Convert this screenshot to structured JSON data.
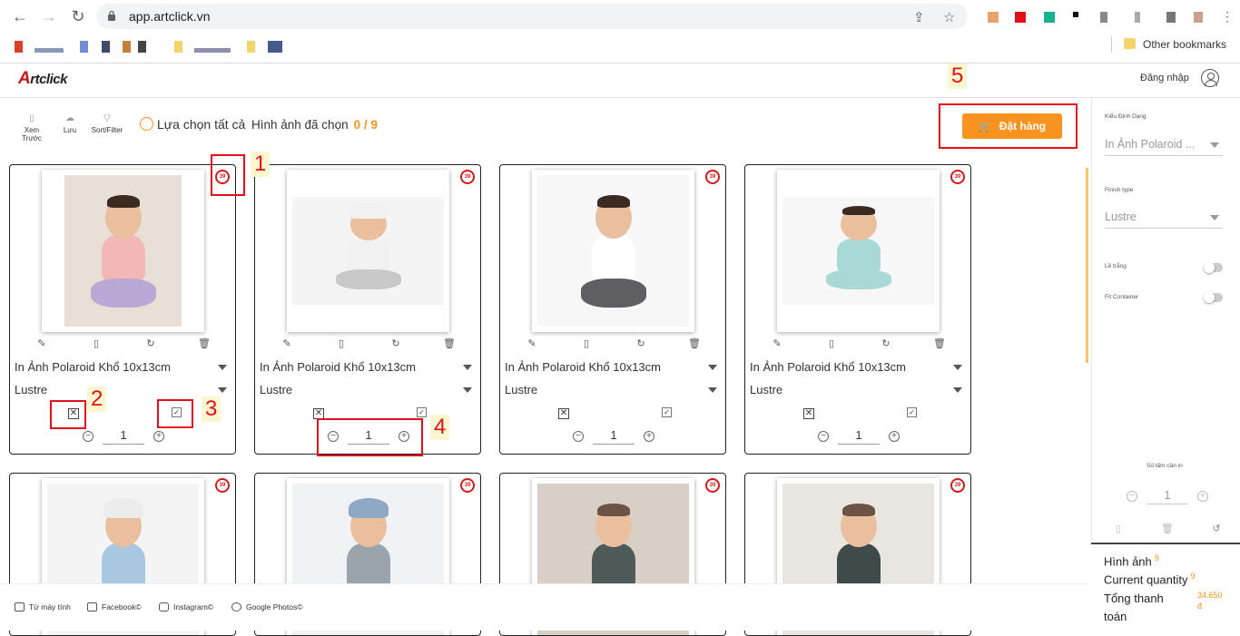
{
  "browser": {
    "url": "app.artclick.vn",
    "other_bookmarks": "Other bookmarks"
  },
  "app": {
    "logo": "rtclick",
    "logo_a": "A",
    "login": "Đăng nhập"
  },
  "toolbar": {
    "preview": "Xem Trước",
    "save": "Lưu",
    "sort": "Sort/Filter",
    "select_all": "Lựa chọn tất cả",
    "selected_label": "Hình ảnh đã chọn",
    "selected_count": "0 / 9",
    "order": "Đặt hàng"
  },
  "annotations": [
    "1",
    "2",
    "3",
    "4",
    "5"
  ],
  "cards": [
    {
      "badge": "39",
      "product": "In Ảnh Polaroid Khổ 10x13cm",
      "finish": "Lustre",
      "qty": "1"
    },
    {
      "badge": "39",
      "product": "In Ảnh Polaroid Khổ 10x13cm",
      "finish": "Lustre",
      "qty": "1"
    },
    {
      "badge": "39",
      "product": "In Ảnh Polaroid Khổ 10x13cm",
      "finish": "Lustre",
      "qty": "1"
    },
    {
      "badge": "39",
      "product": "In Ảnh Polaroid Khổ 10x13cm",
      "finish": "Lustre",
      "qty": "1"
    },
    {
      "badge": "39"
    },
    {
      "badge": "39"
    },
    {
      "badge": "39"
    },
    {
      "badge": "39"
    }
  ],
  "sidebar": {
    "format_label": "Kiểu Định Dạng",
    "format_value": "In Ảnh Polaroid ...",
    "finish_label": "Finish type",
    "finish_value": "Lustre",
    "border_label": "Lề trắng",
    "fit_label": "Fit Container",
    "copies_label": "Số tấm cần in",
    "copies_value": "1"
  },
  "summary": {
    "images_label": "Hình ảnh",
    "images_count": "9",
    "qty_label": "Current quantity",
    "qty_value": "9",
    "total_label": "Tổng thanh toán",
    "total_value": "34.650",
    "currency": "đ"
  },
  "footer": {
    "computer": "Từ máy tính",
    "facebook": "Facebook©",
    "instagram": "Instagram©",
    "google": "Google Photos©"
  },
  "colors": {
    "accent": "#f7931e",
    "annotation": "#e3101a"
  }
}
